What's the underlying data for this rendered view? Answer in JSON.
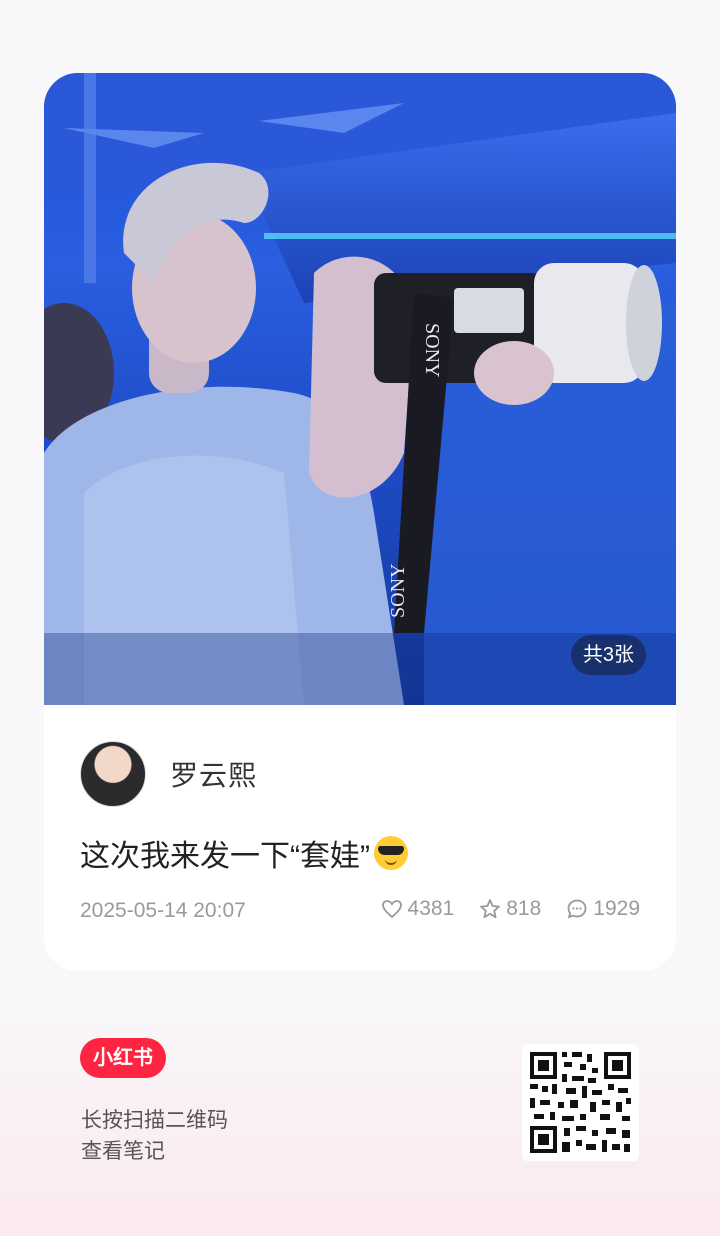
{
  "post": {
    "image_count_label": "共3张",
    "author_name": "罗云熙",
    "title": "这次我来发一下“套娃”",
    "title_emoji": "sunglasses-emoji",
    "date": "2025-05-14 20:07",
    "likes": "4381",
    "collects": "818",
    "comments": "1929"
  },
  "footer": {
    "brand_label": "小红书",
    "hint_line1": "长按扫描二维码",
    "hint_line2": "查看笔记"
  },
  "colors": {
    "brand": "#ff2442",
    "meta_text": "#9a9a9a"
  }
}
